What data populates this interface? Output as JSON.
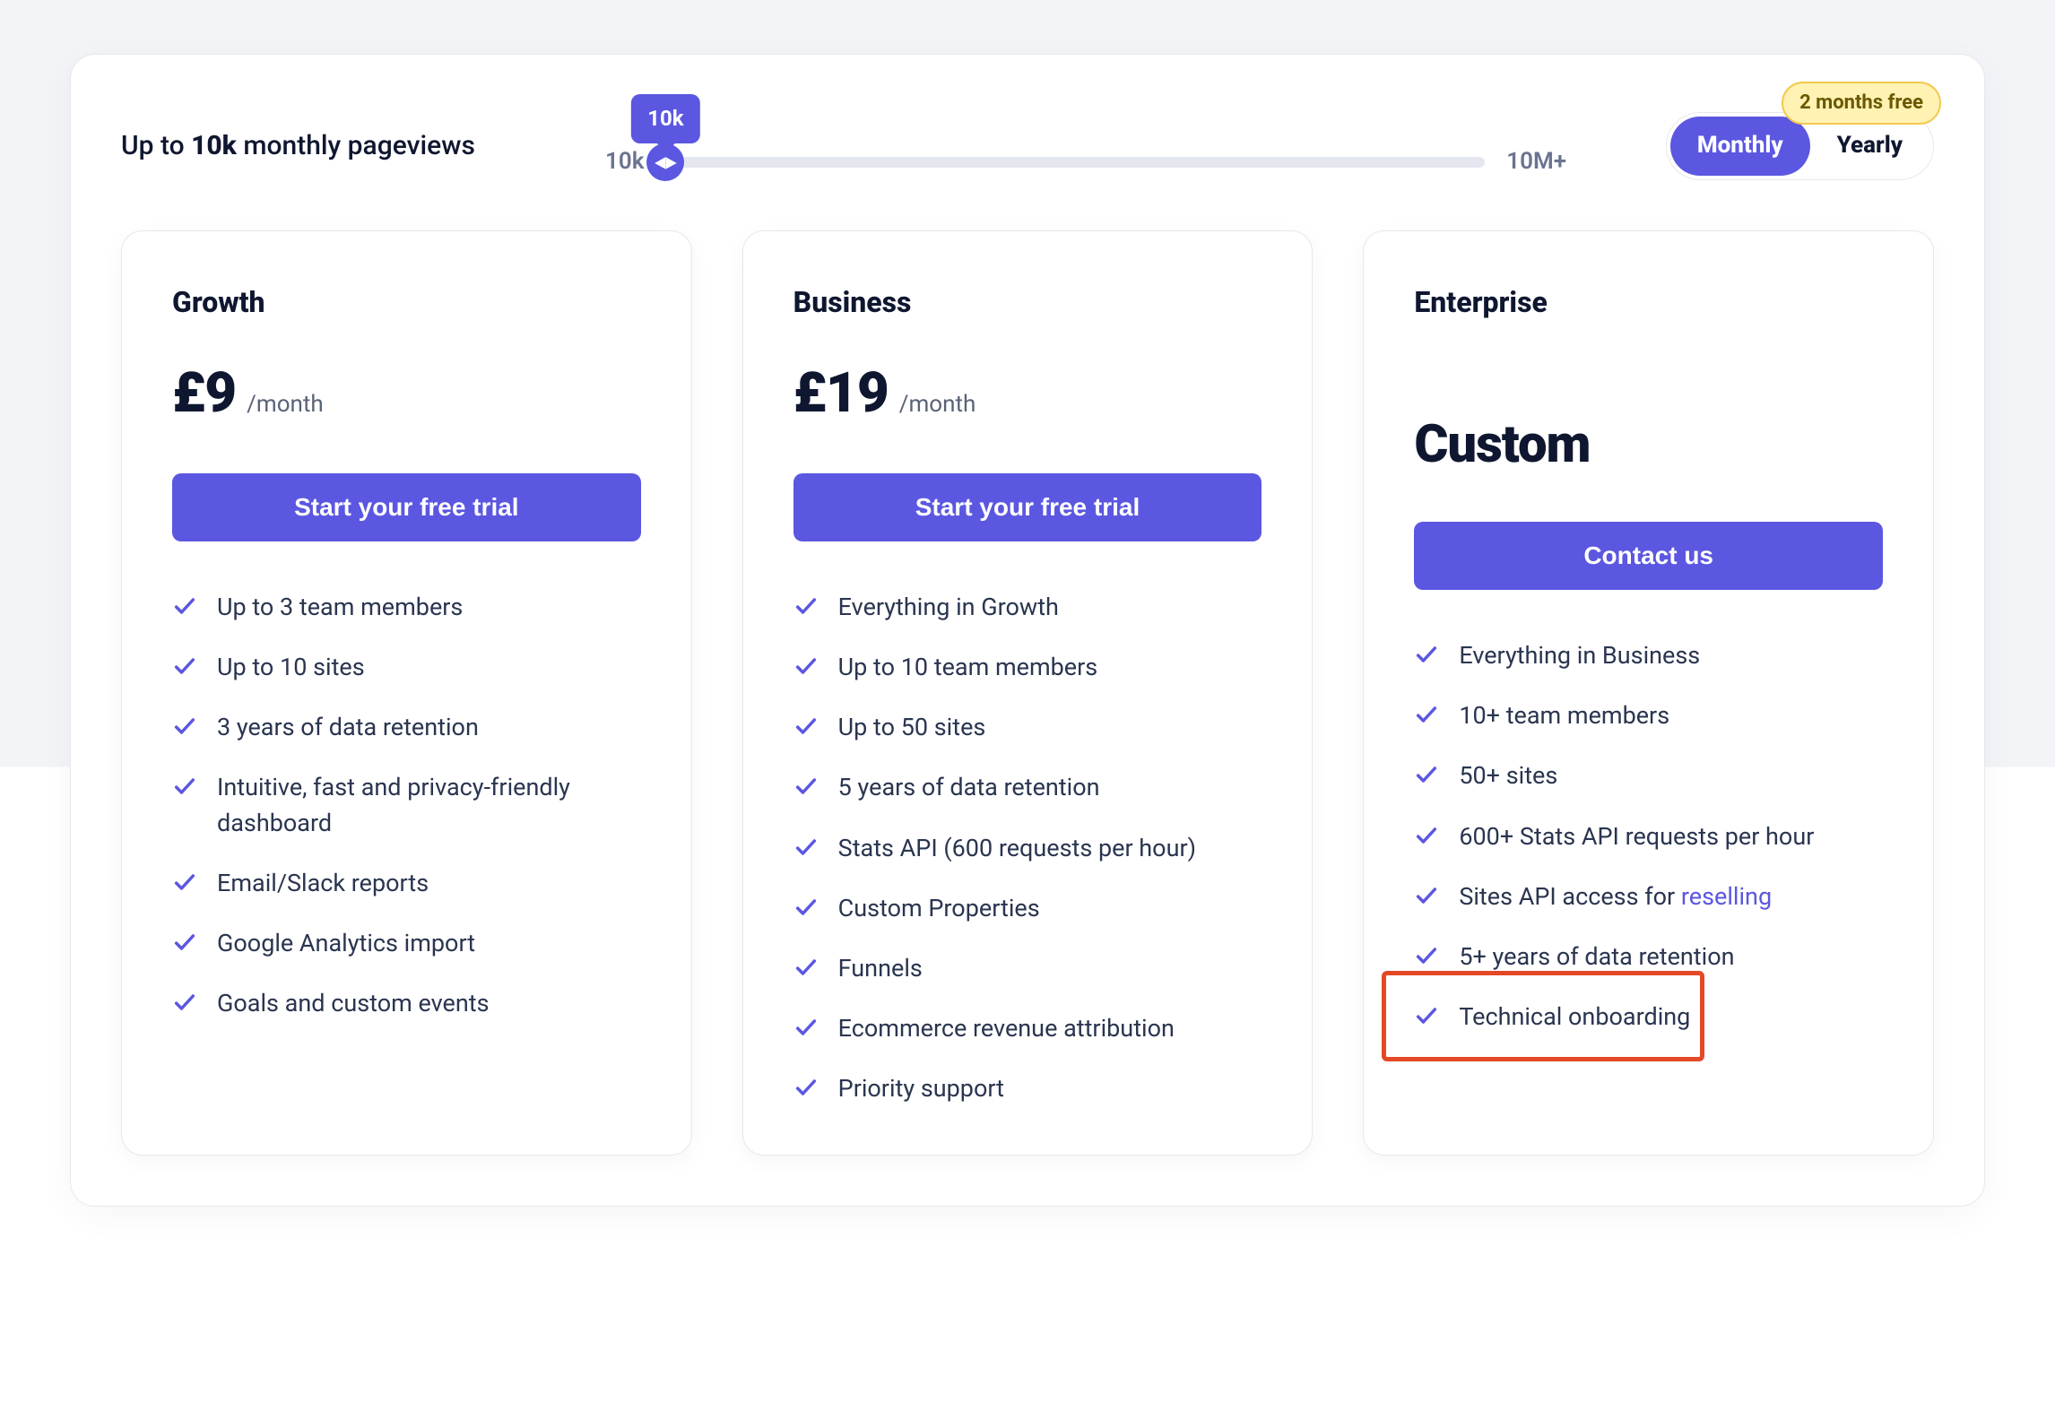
{
  "headline": {
    "prefix": "Up to ",
    "value": "10k",
    "suffix": " monthly pageviews"
  },
  "slider": {
    "min": "10k",
    "max": "10M+",
    "tooltip": "10k",
    "position_pct": 0
  },
  "billing": {
    "monthly": "Monthly",
    "yearly": "Yearly",
    "active": "monthly",
    "promo": "2 months free"
  },
  "plans": [
    {
      "id": "growth",
      "name": "Growth",
      "price": "£9",
      "period": "/month",
      "cta": "Start your free trial",
      "features": [
        "Up to 3 team members",
        "Up to 10 sites",
        "3 years of data retention",
        "Intuitive, fast and privacy-friendly dashboard",
        "Email/Slack reports",
        "Google Analytics import",
        "Goals and custom events"
      ]
    },
    {
      "id": "business",
      "name": "Business",
      "price": "£19",
      "period": "/month",
      "cta": "Start your free trial",
      "features": [
        "Everything in Growth",
        "Up to 10 team members",
        "Up to 50 sites",
        "5 years of data retention",
        "Stats API (600 requests per hour)",
        "Custom Properties",
        "Funnels",
        "Ecommerce revenue attribution",
        "Priority support"
      ]
    },
    {
      "id": "enterprise",
      "name": "Enterprise",
      "custom_price": "Custom",
      "cta": "Contact us",
      "features": [
        "Everything in Business",
        "10+ team members",
        "50+ sites",
        "600+ Stats API requests per hour",
        {
          "text": "Sites API access for ",
          "link_text": "reselling"
        },
        "5+ years of data retention",
        "Technical onboarding"
      ],
      "highlight_feature_index": 6
    }
  ]
}
